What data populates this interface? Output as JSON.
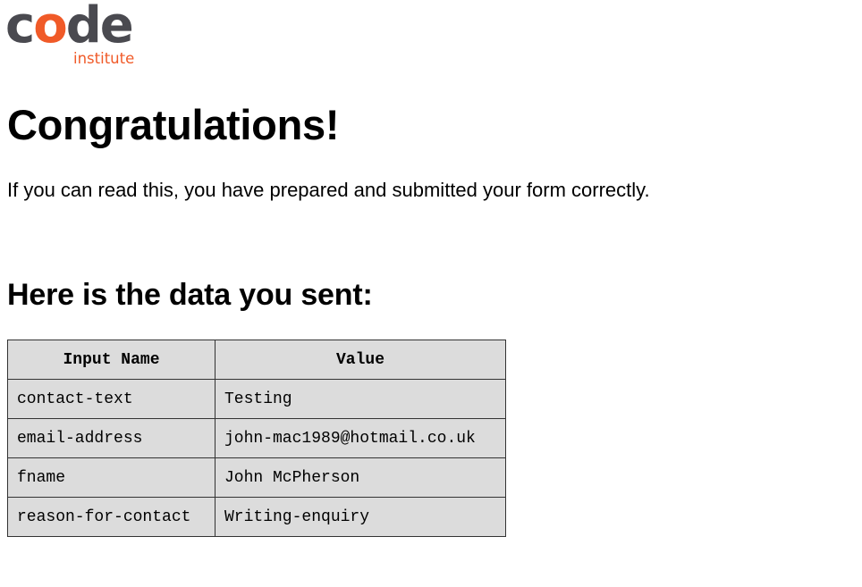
{
  "logo": {
    "part1": "c",
    "accent": "o",
    "part2": "de",
    "sub": "institute",
    "primary_color": "#4a4a50",
    "accent_color": "#f05a28"
  },
  "heading": "Congratulations!",
  "intro": "If you can read this, you have prepared and submitted your form correctly.",
  "subheading": "Here is the data you sent:",
  "table": {
    "headers": [
      "Input Name",
      "Value"
    ],
    "rows": [
      [
        "contact-text",
        "Testing"
      ],
      [
        "email-address",
        "john-mac1989@hotmail.co.uk"
      ],
      [
        "fname",
        "John McPherson"
      ],
      [
        "reason-for-contact",
        "Writing-enquiry"
      ]
    ],
    "background": "#dcdcdc"
  }
}
